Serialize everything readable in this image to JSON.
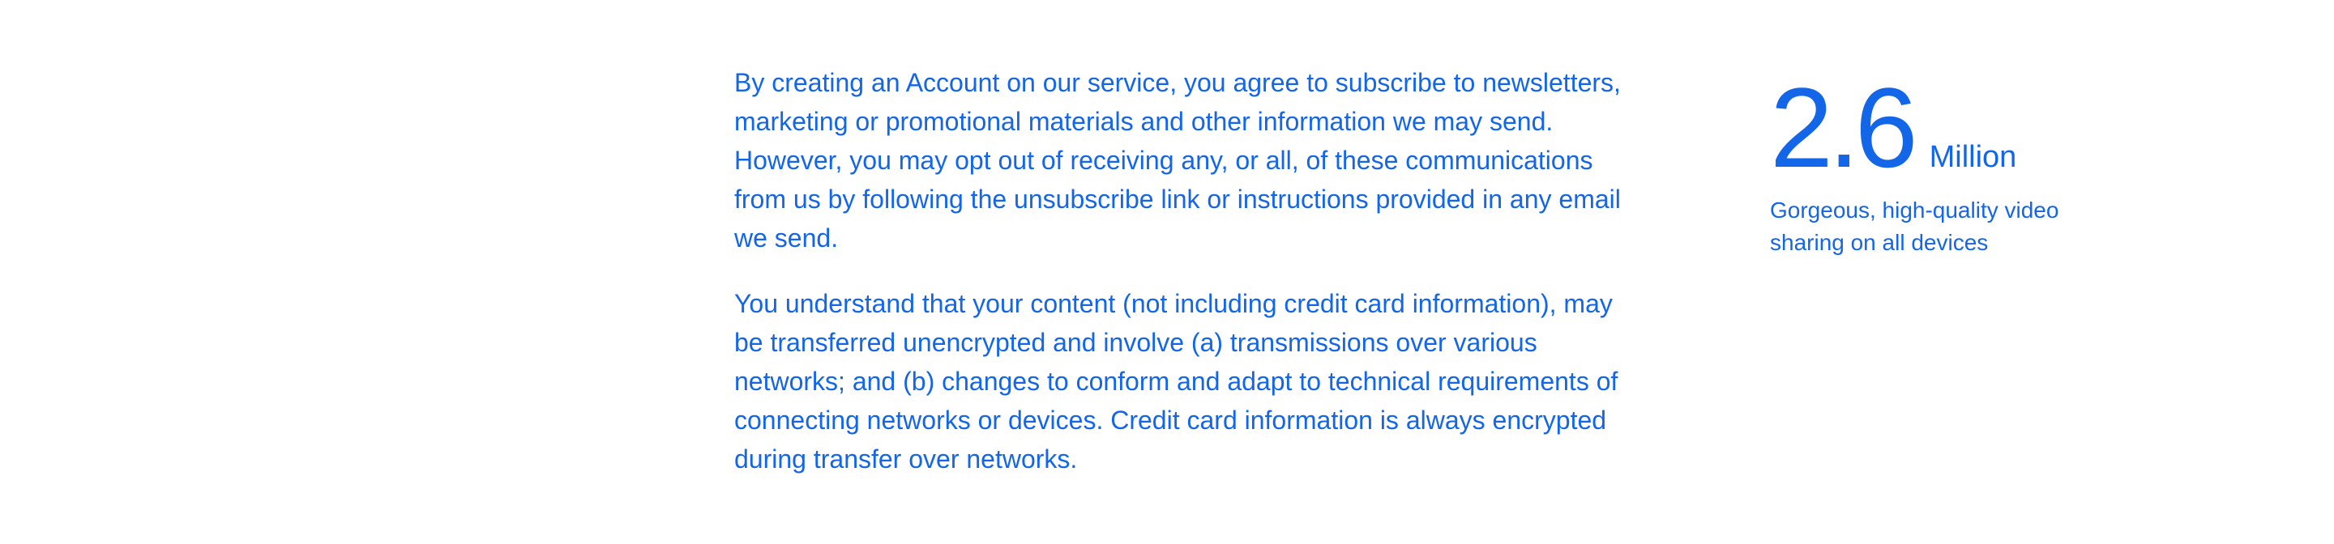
{
  "terms": {
    "paragraph_1": "By creating an Account on our service, you agree to subscribe to newsletters, marketing or promotional materials and other information we may send. However, you may opt out of receiving any, or all, of these communications from us by following the unsubscribe link or instructions provided in any email we send.",
    "paragraph_2": "You understand that your content (not including credit card information), may be transferred unencrypted and involve (a) transmissions over various networks; and (b) changes to conform and adapt to technical requirements of connecting networks or devices. Credit card information is always encrypted during transfer over networks."
  },
  "stat": {
    "number": "2.6",
    "unit": "Million",
    "description": "Gorgeous, high-quality video sharing on all devices"
  },
  "colors": {
    "text": "#1366e8",
    "background": "#ffffff"
  }
}
